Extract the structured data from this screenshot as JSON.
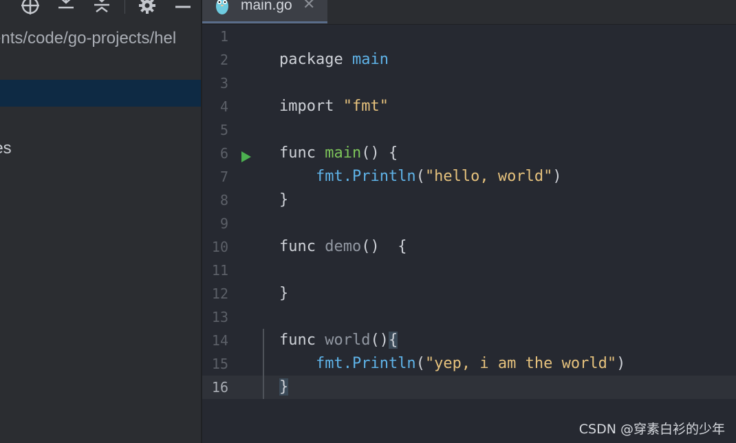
{
  "project_panel": {
    "path": "ents/code/go-projects/hel",
    "tree_item": "les"
  },
  "tab": {
    "filename": "main.go"
  },
  "code_lines": [
    {
      "num": "1"
    },
    {
      "num": "2",
      "t1": "package ",
      "t2": "main"
    },
    {
      "num": "3"
    },
    {
      "num": "4",
      "t1": "import ",
      "t2": "\"fmt\""
    },
    {
      "num": "5"
    },
    {
      "num": "6",
      "t1": "func ",
      "t2": "main",
      "t3": "() {"
    },
    {
      "num": "7",
      "t1": "    ",
      "t2": "fmt.Println",
      "t3": "(",
      "t4": "\"hello, world\"",
      "t5": ")"
    },
    {
      "num": "8",
      "t1": "}"
    },
    {
      "num": "9"
    },
    {
      "num": "10",
      "t1": "func ",
      "t2": "demo",
      "t3": "()  {"
    },
    {
      "num": "11"
    },
    {
      "num": "12",
      "t1": "}"
    },
    {
      "num": "13"
    },
    {
      "num": "14",
      "t1": "func ",
      "t2": "world",
      "t3": "()",
      "t4": "{"
    },
    {
      "num": "15",
      "t1": "    ",
      "t2": "fmt.Println",
      "t3": "(",
      "t4": "\"yep, i am the world\"",
      "t5": ")"
    },
    {
      "num": "16",
      "t1": "}"
    }
  ],
  "watermark": "CSDN @穿素白衫的少年",
  "colors": {
    "keyword": "#cfd2d8",
    "package_name": "#5fb3e8",
    "function_name": "#7dc45a",
    "string": "#e6c27d",
    "run_icon": "#4caf50"
  }
}
